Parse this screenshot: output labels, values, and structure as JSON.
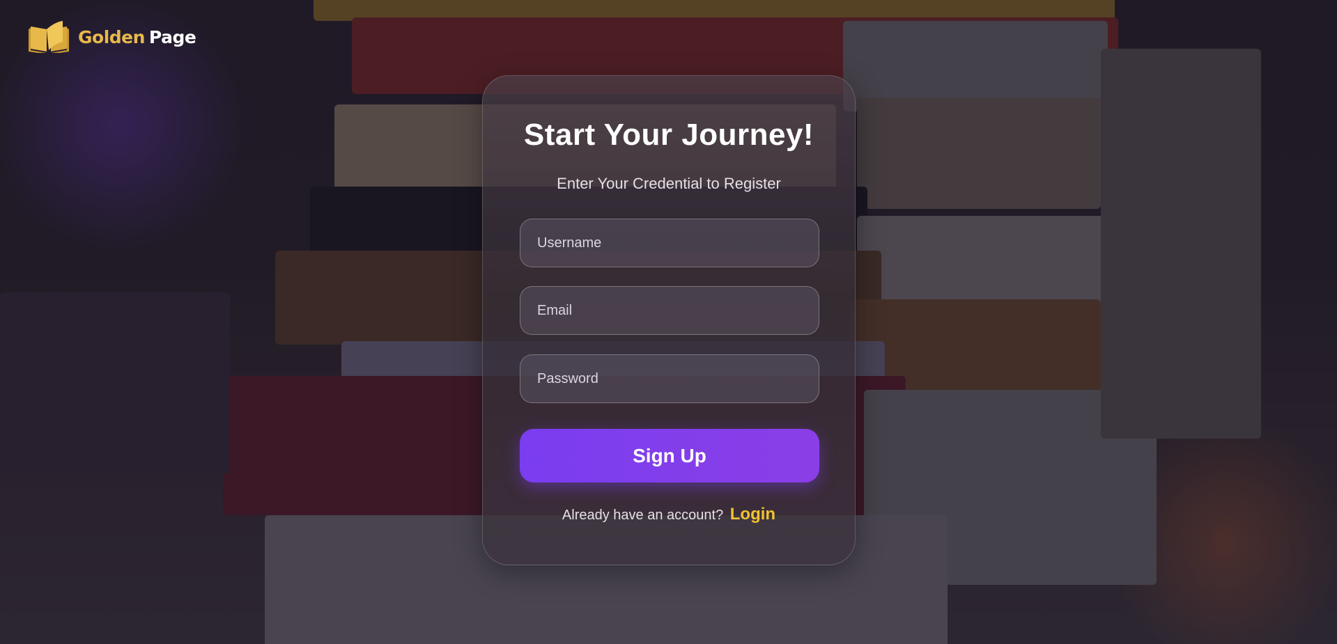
{
  "brand": {
    "name_part1": "Golden",
    "name_part2": "Page",
    "icon": "open-book-icon",
    "gold_color": "#e8b94a"
  },
  "form": {
    "title": "Start Your Journey!",
    "subtitle": "Enter Your Credential to Register",
    "username_placeholder": "Username",
    "email_placeholder": "Email",
    "password_placeholder": "Password",
    "submit_label": "Sign Up",
    "login_prompt": "Already have an account?",
    "login_link": "Login"
  },
  "colors": {
    "accent": "#7a3df0",
    "link": "#f2c230"
  }
}
